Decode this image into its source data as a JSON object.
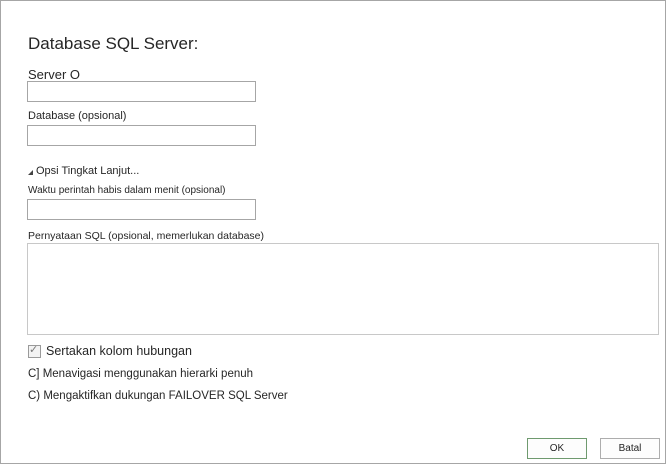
{
  "dialog": {
    "title": "Database SQL Server:"
  },
  "fields": {
    "server_label": "Server O",
    "server_value": "",
    "database_label": "Database (opsional)",
    "database_value": "",
    "advanced_label": "Opsi Tingkat Lanjut...",
    "timeout_label": "Waktu perintah habis dalam menit (opsional)",
    "timeout_value": "",
    "sql_label": "Pernyataan SQL (opsional, memerlukan database)",
    "sql_value": ""
  },
  "options": {
    "include_relationship_label": "Sertakan kolom hubungan",
    "include_relationship_checked": true,
    "hierarchy_label": "C] Menavigasi menggunakan hierarki penuh",
    "failover_label": "C) Mengaktifkan dukungan FAILOVER SQL Server"
  },
  "buttons": {
    "ok_label": "OK",
    "cancel_label": "Batal"
  },
  "icons": {
    "advanced_toggle": "triangle-expand-icon",
    "checkbox_check": "check-icon"
  }
}
